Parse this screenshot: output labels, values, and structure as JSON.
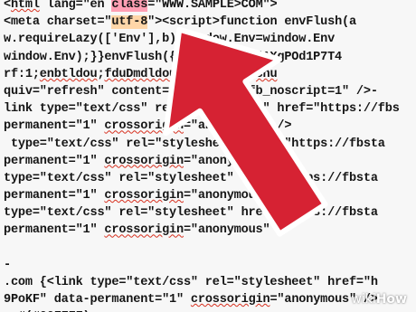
{
  "code_lines": [
    [
      {
        "t": "<"
      },
      {
        "t": "html",
        "s": "spell"
      },
      {
        "t": " ",
        "s": ""
      },
      {
        "t": "lang=\"en"
      },
      {
        "t": " "
      },
      {
        "t": "class",
        "s": "hl-red"
      },
      {
        "t": "=\"WWW.SAMPLE>COM\">"
      }
    ],
    [
      {
        "t": "<meta charset=\""
      },
      {
        "t": "utf-8",
        "s": "hl-orange"
      },
      {
        "t": "\"><script>function envFlush(a"
      }
    ],
    [
      {
        "t": "w.requireLazy(['Env'],b):window.Env=window.Env"
      }
    ],
    [
      {
        "t": "window.Env);}}envFlush({\"ajaxpipe\":\"AXgPOd1P7T4"
      }
    ],
    [
      {
        "t": "rf:1;"
      },
      {
        "t": "enbtldou",
        "s": "spell"
      },
      {
        "t": ";"
      },
      {
        "t": "fduDmdldou",
        "s": "spell"
      },
      {
        "t": ":b;"
      },
      {
        "t": "dptdru",
        "s": "spell"
      },
      {
        "t": ";"
      },
      {
        "t": "gsnu",
        "s": "spell"
      }
    ],
    [
      {
        "t": "quiv=\"refresh\" content=\"0; URL=/?_fb_noscript=1\" />-"
      }
    ],
    [
      {
        "t": "link type=\"text/css\" rel=\"stylesheet\" href=\"https://fbs"
      }
    ],
    [
      {
        "t": "permanent=\"1\" "
      },
      {
        "t": "crossorigin",
        "s": "spell"
      },
      {
        "t": "=\"anonymous\" />"
      }
    ],
    [
      {
        "t": " type=\"text/css\" rel=\"stylesheet\" href=\"https://fbsta"
      }
    ],
    [
      {
        "t": "permanent=\"1\" "
      },
      {
        "t": "crossorigin",
        "s": "spell"
      },
      {
        "t": "=\"anonymous\" />"
      }
    ],
    [
      {
        "t": "type=\"text/css\" rel=\"stylesheet\" href=\"https://fbsta"
      }
    ],
    [
      {
        "t": "permanent=\"1\" "
      },
      {
        "t": "crossorigin",
        "s": "spell"
      },
      {
        "t": "=\"anonymous\" />"
      }
    ],
    [
      {
        "t": "type=\"text/css\" rel=\"stylesheet\" href=\"https://fbsta"
      }
    ],
    [
      {
        "t": "permanent=\"1\" "
      },
      {
        "t": "crossorigin",
        "s": "spell"
      },
      {
        "t": "=\"anonymous\" />"
      }
    ],
    [
      {
        "t": ""
      }
    ],
    [
      {
        "t": "-"
      }
    ],
    [
      {
        "t": ".com {<link type=\"text/css\" rel=\"stylesheet\" href=\"h"
      }
    ],
    [
      {
        "t": "9PoKF\" data-permanent=\"1\" "
      },
      {
        "t": "crossorigin",
        "s": "spell"
      },
      {
        "t": "=\"anonymous\" />"
      }
    ],
    [
      {
        "t": "  #(#00FFFF);"
      }
    ]
  ],
  "watermark": {
    "prefix": "wiki",
    "suffix": "How"
  },
  "colors": {
    "arrow": "#d62233",
    "arrow_outline": "#ffffff",
    "highlight_class": "#ff9fb4",
    "highlight_charset": "#ffd6a8",
    "spellcheck": "#d7301f"
  },
  "icons": {
    "arrow": "big-red-pointer-arrow"
  }
}
